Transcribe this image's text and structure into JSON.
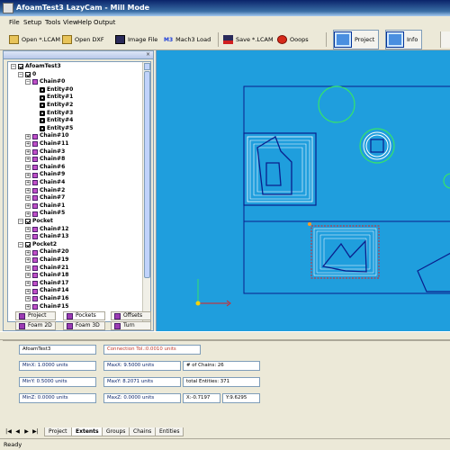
{
  "window": {
    "title": "AfoamTest3 LazyCam - Mill Mode"
  },
  "menu": [
    "File",
    "Setup",
    "Tools",
    "View",
    "Help",
    "Output"
  ],
  "toolbar": {
    "open_lcam": "Open *.LCAM",
    "open_dxf": "Open DXF",
    "image_file": "Image File",
    "mach3_load": "Mach3 Load",
    "save_lcam": "Save *.LCAM",
    "ooops": "Ooops",
    "project": "Project",
    "info": "Info"
  },
  "tree": {
    "root": "AfoamTest3",
    "group0": "0",
    "chain0": "Chain#0",
    "entities": [
      "Entity#0",
      "Entity#1",
      "Entity#2",
      "Entity#3",
      "Entity#4",
      "Entity#5"
    ],
    "chains_a": [
      "Chain#10",
      "Chain#11",
      "Chain#3",
      "Chain#8",
      "Chain#6",
      "Chain#9",
      "Chain#4",
      "Chain#2",
      "Chain#7",
      "Chain#1",
      "Chain#5"
    ],
    "pocket": "Pocket",
    "pocket_chains": [
      "Chain#12",
      "Chain#13"
    ],
    "pocket2": "Pocket2",
    "pocket2_chains": [
      "Chain#20",
      "Chain#19",
      "Chain#21",
      "Chain#18",
      "Chain#17",
      "Chain#14",
      "Chain#16",
      "Chain#15"
    ]
  },
  "left_tabs": {
    "project": "Project",
    "pockets": "Pockets",
    "offsets": "Offsets",
    "foam2d": "Foam 2D",
    "foam3d": "Foam 3D",
    "turn": "Turn"
  },
  "info": {
    "name": "AfoamTest3",
    "connection_tol": "Connection Tol.:0.0010 units",
    "minx": "MinX: 1.0000 units",
    "maxx": "MaxX: 9.5000 units",
    "chains": "# of Chains: 26",
    "miny": "MinY: 0.5000 units",
    "maxy": "MaxY: 8.2071 units",
    "total_entities": "total Entities: 371",
    "minz": "MinZ: 0.0000 units",
    "maxz": "MaxZ: 0.0000 units",
    "x": "X:-0.7197",
    "y": "Y:9.6295"
  },
  "bottom_tabs": [
    "Project",
    "Extents",
    "Groups",
    "Chains",
    "Entities"
  ],
  "bottom_active_tab": "Extents",
  "status": "Ready",
  "colors": {
    "canvas": "#1f9edd",
    "path": "#0a1e8c",
    "toolpath": "#ffffff",
    "circle": "#36e36a",
    "red_offset": "#e02020"
  }
}
